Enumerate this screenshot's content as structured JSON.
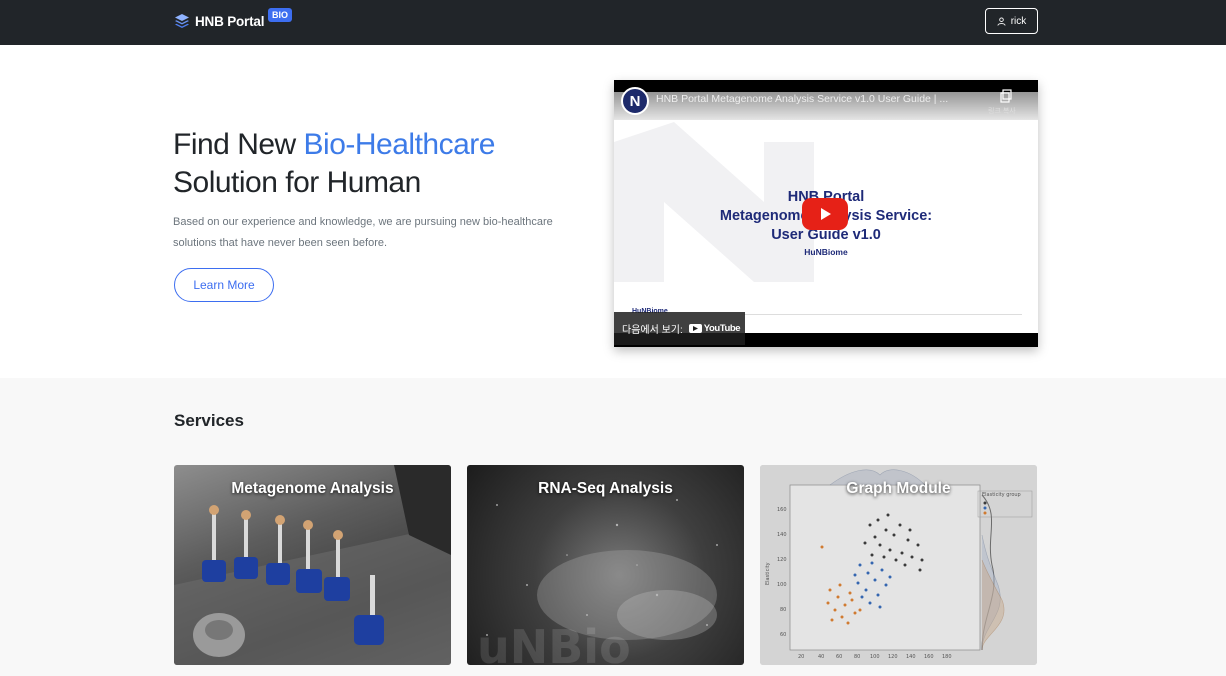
{
  "navbar": {
    "brand": "HNB Portal",
    "badge": "BIO",
    "user": "rick"
  },
  "hero": {
    "title_prefix": "Find New ",
    "title_accent": "Bio-Healthcare",
    "title_line2": "Solution for Human",
    "description": "Based on our experience and knowledge, we are pursuing new bio-healthcare solutions that have never been seen before.",
    "cta": "Learn More"
  },
  "video": {
    "title": "HNB Portal Metagenome Analysis Service v1.0 User Guide | ...",
    "copy_label": "링크 복사",
    "channel_initial": "N",
    "slide_title_line1": "HNB Portal",
    "slide_title_line2": "Metagenome Analysis Service:",
    "slide_title_line3": "User Guide v1.0",
    "slide_subtitle": "HuNBiome",
    "slide_footer": "HuNBiome",
    "watch_on": "다음에서 보기:",
    "youtube": "YouTube"
  },
  "services": {
    "title": "Services",
    "cards": [
      {
        "label": "Metagenome Analysis"
      },
      {
        "label": "RNA-Seq Analysis"
      },
      {
        "label": "Graph Module"
      }
    ]
  },
  "colors": {
    "navbar": "#212529",
    "accent": "#3d6ef0",
    "accent_text": "#3d7be8",
    "youtube_red": "#e62117",
    "slide_navy": "#1e2a78"
  }
}
